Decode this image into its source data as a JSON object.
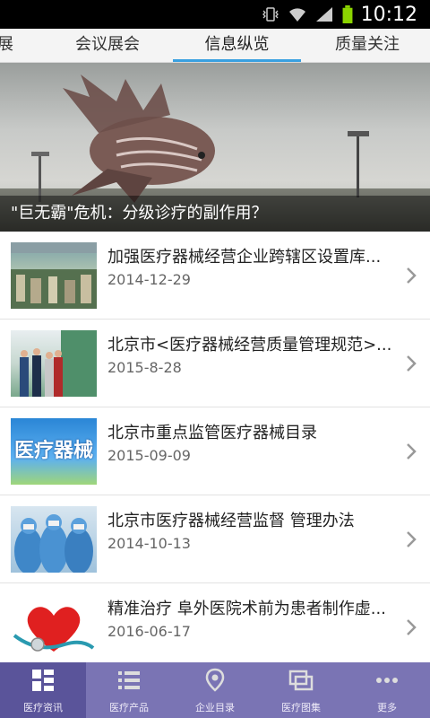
{
  "status": {
    "time": "10:12"
  },
  "tabs": [
    {
      "label": "展"
    },
    {
      "label": "会议展会"
    },
    {
      "label": "信息纵览"
    },
    {
      "label": "质量关注"
    }
  ],
  "banner": {
    "caption": "\"巨无霸\"危机：分级诊疗的副作用？"
  },
  "articles": [
    {
      "title": "加强医疗器械经营企业跨辖区设置库...",
      "date": "2014-12-29",
      "thumb": "warehouse-photo"
    },
    {
      "title": "北京市<医疗器械经营质量管理规范>...",
      "date": "2015-8-28",
      "thumb": "inspection-photo"
    },
    {
      "title": "北京市重点监管医疗器械目录",
      "date": "2015-09-09",
      "thumb": "medical-device-text-image"
    },
    {
      "title": "北京市医疗器械经营监督 管理办法",
      "date": "2014-10-13",
      "thumb": "cleanroom-photo"
    },
    {
      "title": "精准治疗 阜外医院术前为患者制作虚...",
      "date": "2016-06-17",
      "thumb": "heart-stethoscope-photo"
    }
  ],
  "thumb_text": {
    "medical": "医疗器械"
  },
  "nav": [
    {
      "label": "医疗资讯",
      "icon": "news-grid-icon",
      "active": true
    },
    {
      "label": "医疗产品",
      "icon": "list-icon",
      "active": false
    },
    {
      "label": "企业目录",
      "icon": "location-pin-icon",
      "active": false
    },
    {
      "label": "医疗图集",
      "icon": "gallery-icon",
      "active": false
    },
    {
      "label": "更多",
      "icon": "more-icon",
      "active": false
    }
  ],
  "colors": {
    "tab_indicator": "#3aa0e0",
    "bottom_nav": "#7a74b4",
    "bottom_nav_active": "#5a549a"
  }
}
